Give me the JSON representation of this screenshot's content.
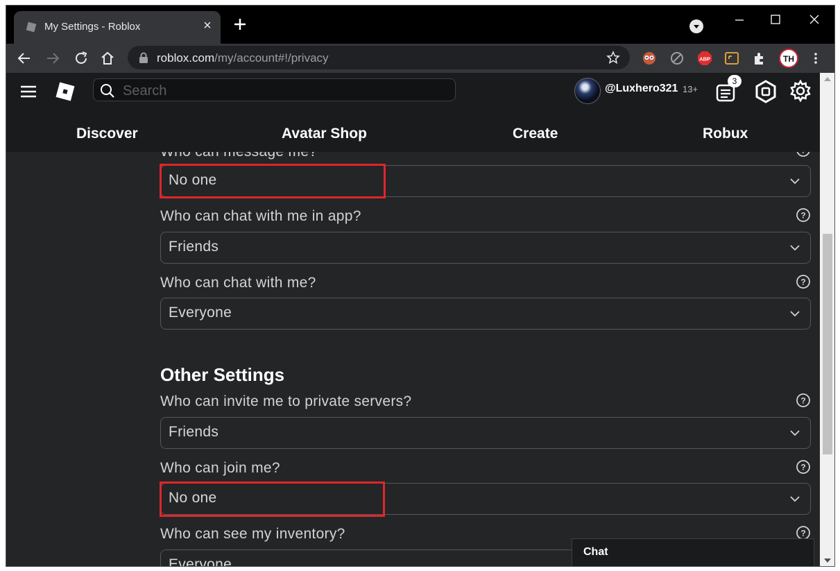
{
  "browser": {
    "tab_title": "My Settings - Roblox",
    "url_host": "roblox.com",
    "url_path": "/my/account#!/privacy"
  },
  "header": {
    "search_placeholder": "Search",
    "username": "@Luxhero321",
    "age_label": "13+",
    "notification_count": "3",
    "nav": {
      "discover": "Discover",
      "avatar_shop": "Avatar Shop",
      "create": "Create",
      "robux": "Robux"
    }
  },
  "settings": {
    "message": {
      "label": "Who can message me?",
      "value": "No one"
    },
    "chat_app": {
      "label": "Who can chat with me in app?",
      "value": "Friends"
    },
    "chat": {
      "label": "Who can chat with me?",
      "value": "Everyone"
    },
    "other_title": "Other Settings",
    "invite": {
      "label": "Who can invite me to private servers?",
      "value": "Friends"
    },
    "join": {
      "label": "Who can join me?",
      "value": "No one"
    },
    "inventory": {
      "label": "Who can see my inventory?",
      "value": "Everyone"
    }
  },
  "chat_panel": {
    "title": "Chat"
  },
  "colors": {
    "highlight": "#e0252b",
    "background": "#232527",
    "header": "#191b1d"
  },
  "icons": [
    "roblox-favicon",
    "close-icon",
    "plus-icon",
    "back-arrow-icon",
    "forward-arrow-icon",
    "reload-icon",
    "home-icon",
    "lock-icon",
    "star-icon",
    "extensions-icon",
    "hamburger-icon",
    "roblox-logo",
    "search-icon",
    "notifications-icon",
    "robux-icon",
    "gear-icon",
    "help-icon",
    "chevron-down-icon"
  ]
}
